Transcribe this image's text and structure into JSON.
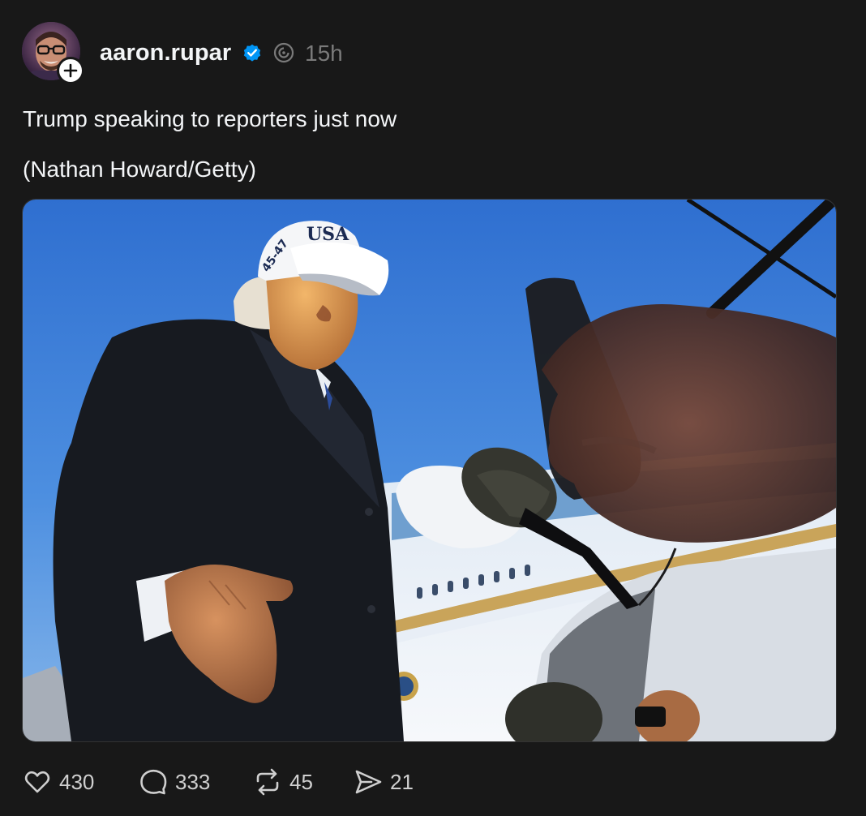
{
  "post": {
    "author": {
      "username": "aaron.rupar",
      "verified": true,
      "avatar_icon": "user-avatar",
      "follow_icon": "plus-icon"
    },
    "timestamp": "15h",
    "caption_lines": [
      "Trump speaking to reporters just now",
      "(Nathan Howard/Getty)"
    ],
    "image": {
      "subject": "photo",
      "hat_text": "USA",
      "hat_side_text": "45-47"
    },
    "actions": {
      "like": {
        "icon": "heart-icon",
        "count": "430"
      },
      "reply": {
        "icon": "comment-icon",
        "count": "333"
      },
      "repost": {
        "icon": "repost-icon",
        "count": "45"
      },
      "share": {
        "icon": "send-icon",
        "count": "21"
      }
    }
  },
  "colors": {
    "background": "#181818",
    "text": "#f3f5f7",
    "muted": "#7a7a7a",
    "verified": "#0095f6"
  }
}
